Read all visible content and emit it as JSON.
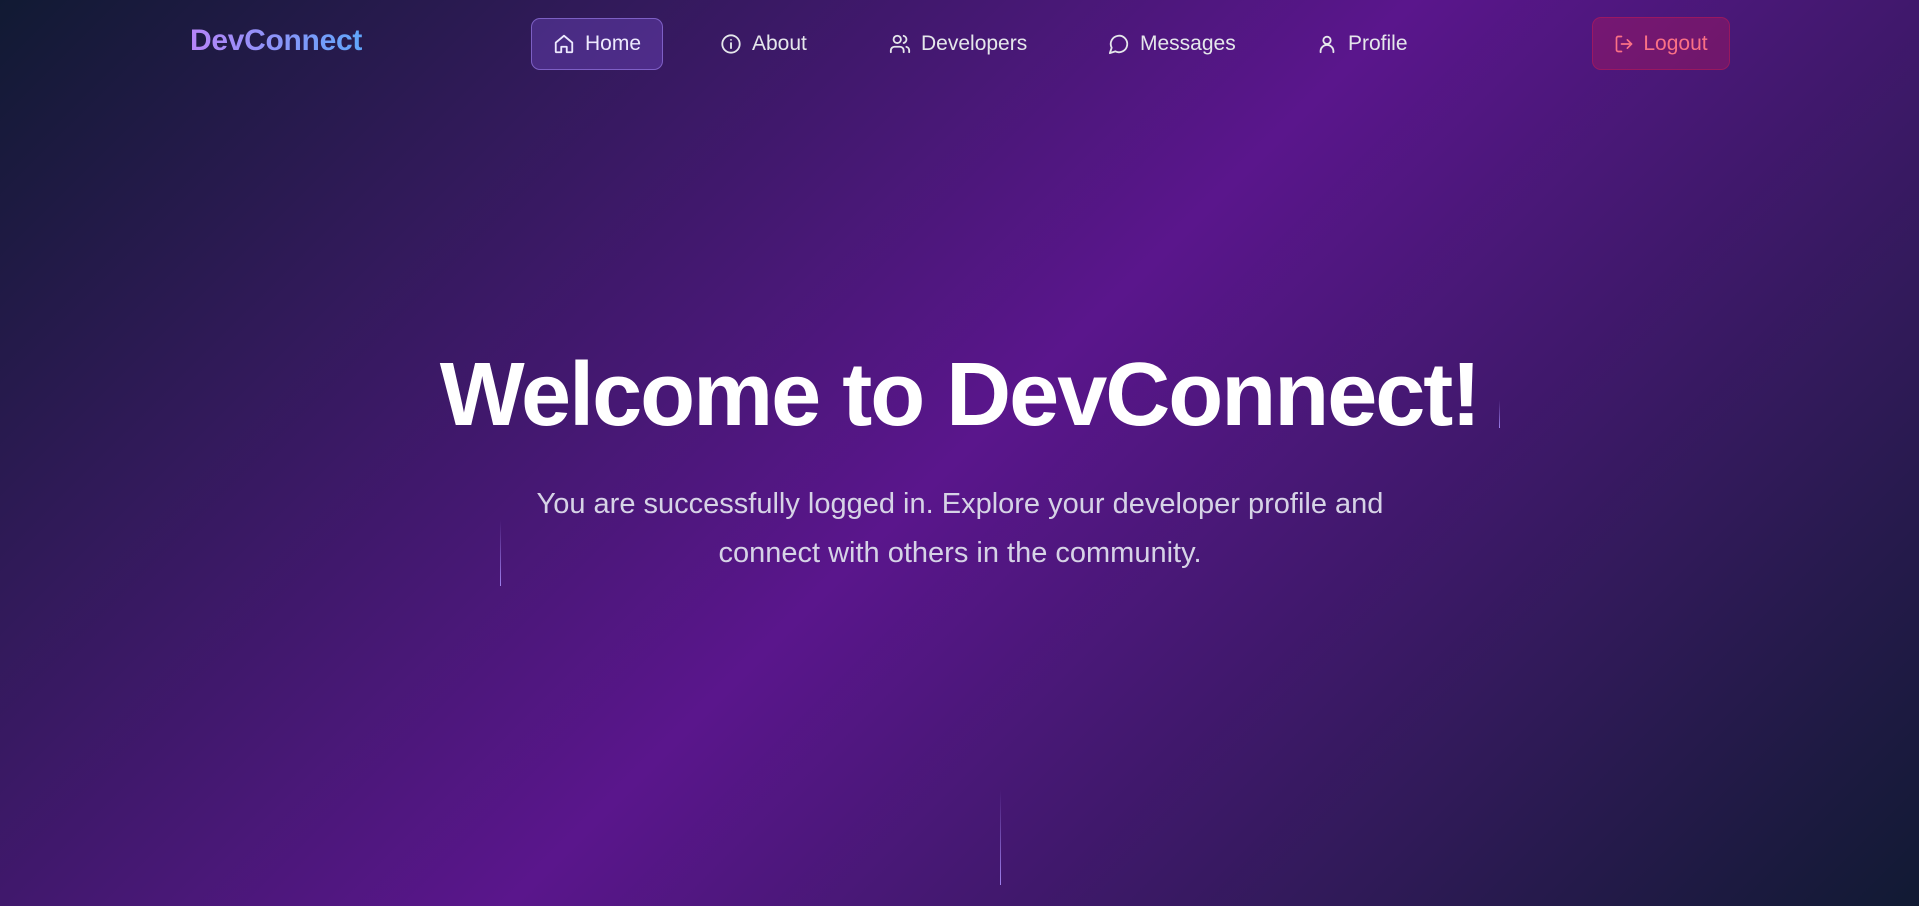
{
  "brand": {
    "name": "DevConnect"
  },
  "nav": {
    "items": [
      {
        "label": "Home",
        "icon": "home-icon",
        "active": true
      },
      {
        "label": "About",
        "icon": "info-icon",
        "active": false
      },
      {
        "label": "Developers",
        "icon": "users-icon",
        "active": false
      },
      {
        "label": "Messages",
        "icon": "message-circle-icon",
        "active": false
      },
      {
        "label": "Profile",
        "icon": "user-icon",
        "active": false
      }
    ],
    "logout": {
      "label": "Logout",
      "icon": "logout-icon"
    }
  },
  "hero": {
    "title": "Welcome to DevConnect!",
    "subtitle_line1": "You are successfully logged in. Explore your developer profile and",
    "subtitle_line2": "connect with others in the community."
  },
  "colors": {
    "brand_gradient_start": "#b784f8",
    "brand_gradient_end": "#60a5fa",
    "background_center": "#5a168c",
    "background_edge": "#111a33",
    "logout_text": "#fb7185",
    "active_nav_bg": "#8b5cf6"
  }
}
